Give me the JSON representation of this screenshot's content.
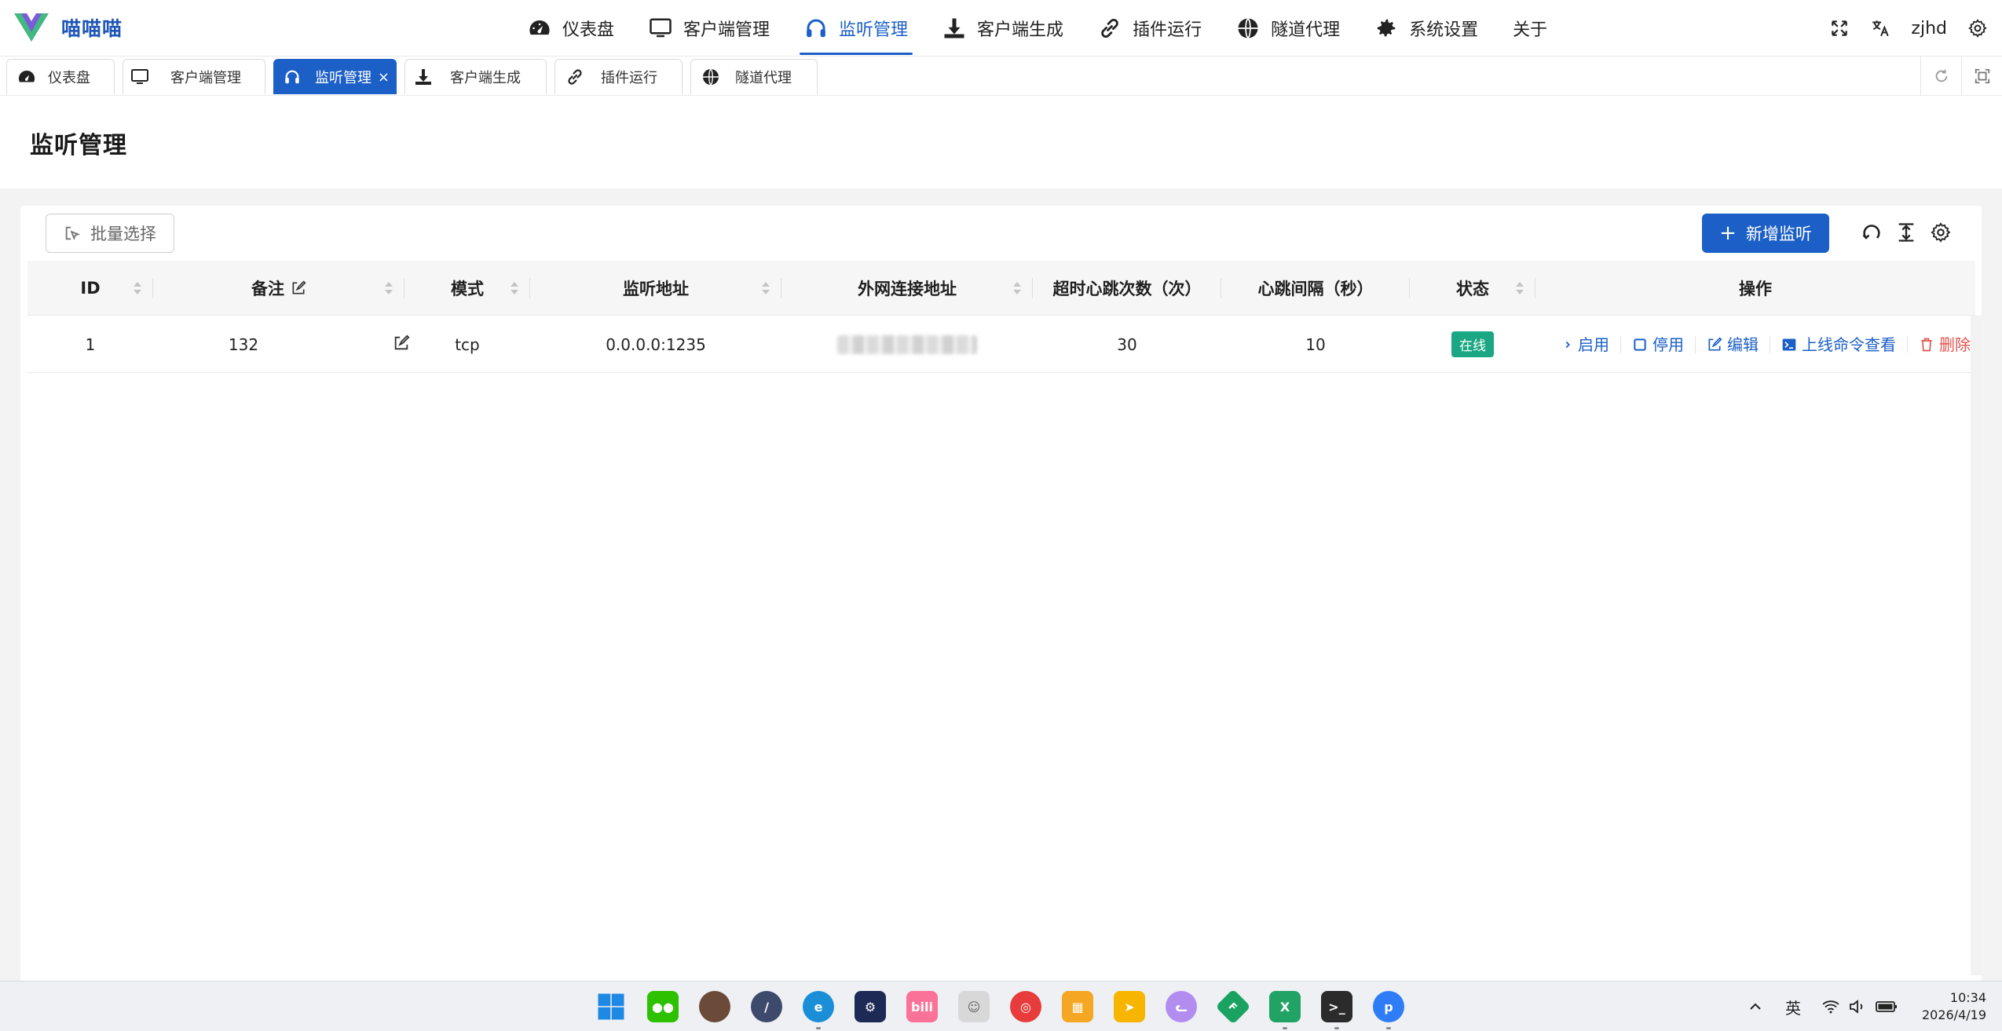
{
  "app": {
    "name": "喵喵喵"
  },
  "nav": {
    "items": [
      {
        "label": "仪表盘",
        "icon": "dashboard-icon"
      },
      {
        "label": "客户端管理",
        "icon": "monitor-icon"
      },
      {
        "label": "监听管理",
        "icon": "headphones-icon",
        "active": true
      },
      {
        "label": "客户端生成",
        "icon": "download-icon"
      },
      {
        "label": "插件运行",
        "icon": "link-icon"
      },
      {
        "label": "隧道代理",
        "icon": "globe-icon"
      },
      {
        "label": "系统设置",
        "icon": "gear-icon"
      },
      {
        "label": "关于"
      }
    ],
    "user": "zjhd"
  },
  "tabs": [
    {
      "label": "仪表盘",
      "icon": "dashboard-icon"
    },
    {
      "label": "客户端管理",
      "icon": "monitor-icon"
    },
    {
      "label": "监听管理",
      "icon": "headphones-icon",
      "active": true
    },
    {
      "label": "客户端生成",
      "icon": "download-icon"
    },
    {
      "label": "插件运行",
      "icon": "link-icon"
    },
    {
      "label": "隧道代理",
      "icon": "globe-icon"
    }
  ],
  "page": {
    "title": "监听管理"
  },
  "toolbar": {
    "batch_select": "批量选择",
    "add_listener": "新增监听"
  },
  "table": {
    "columns": [
      "ID",
      "备注",
      "模式",
      "监听地址",
      "外网连接地址",
      "超时心跳次数（次）",
      "心跳间隔（秒）",
      "状态",
      "操作"
    ],
    "rows": [
      {
        "id": "1",
        "note": "132",
        "mode": "tcp",
        "listen_addr": "0.0.0.0:1235",
        "timeout_count": "30",
        "interval": "10",
        "status": "在线",
        "status_color": "#1ba784"
      }
    ],
    "actions": [
      "启用",
      "停用",
      "编辑",
      "上线命令查看",
      "删除"
    ]
  },
  "colors": {
    "primary": "#1b5fc7",
    "danger": "#e0534f",
    "success": "#1ba784"
  },
  "taskbar": {
    "ime": "英",
    "time": "10:34",
    "date": "2026/4/19"
  }
}
